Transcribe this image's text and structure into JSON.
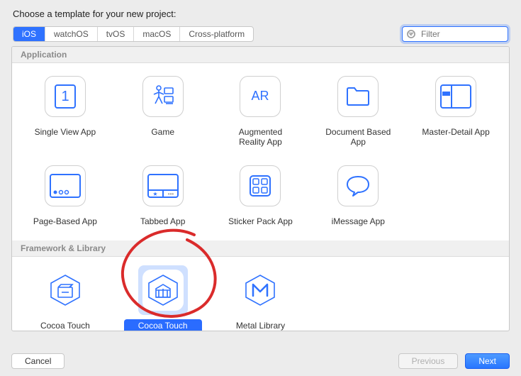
{
  "prompt": "Choose a template for your new project:",
  "platform_tabs": [
    "iOS",
    "watchOS",
    "tvOS",
    "macOS",
    "Cross-platform"
  ],
  "platform_tabs_selected_index": 0,
  "filter_placeholder": "Filter",
  "sections": {
    "application": {
      "header": "Application",
      "items": [
        {
          "label": "Single View App",
          "icon": "single-view"
        },
        {
          "label": "Game",
          "icon": "game"
        },
        {
          "label": "Augmented Reality App",
          "icon": "ar"
        },
        {
          "label": "Document Based App",
          "icon": "document"
        },
        {
          "label": "Master-Detail App",
          "icon": "master-detail"
        },
        {
          "label": "Page-Based App",
          "icon": "page-based"
        },
        {
          "label": "Tabbed App",
          "icon": "tabbed"
        },
        {
          "label": "Sticker Pack App",
          "icon": "sticker"
        },
        {
          "label": "iMessage App",
          "icon": "imessage"
        }
      ]
    },
    "framework": {
      "header": "Framework & Library",
      "items": [
        {
          "label": "Cocoa Touch Framework",
          "icon": "framework"
        },
        {
          "label": "Cocoa Touch Static Library",
          "icon": "static-library",
          "selected": true
        },
        {
          "label": "Metal Library",
          "icon": "metal"
        }
      ]
    }
  },
  "buttons": {
    "cancel": "Cancel",
    "previous": "Previous",
    "next": "Next"
  },
  "colors": {
    "accent": "#2f72ff",
    "annotation": "#da2b2b"
  }
}
